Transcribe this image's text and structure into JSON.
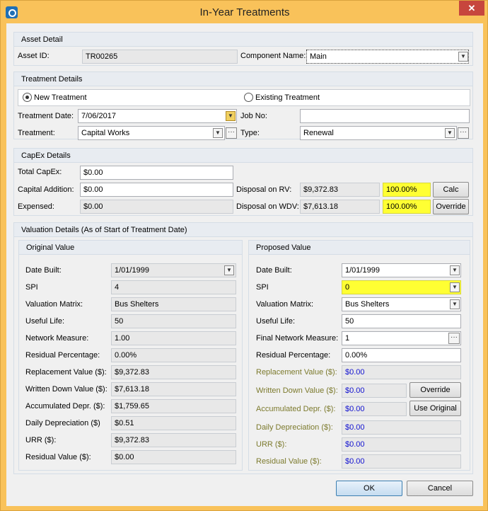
{
  "window": {
    "title": "In-Year Treatments",
    "close_glyph": "✕"
  },
  "asset_detail": {
    "header": "Asset Detail",
    "asset_id_label": "Asset ID:",
    "asset_id": "TR00265",
    "component_label": "Component Name:",
    "component": "Main"
  },
  "treatment_details": {
    "header": "Treatment Details",
    "new_label": "New Treatment",
    "existing_label": "Existing Treatment",
    "selected": "New Treatment",
    "date_label": "Treatment Date:",
    "date": "7/06/2017",
    "job_label": "Job No:",
    "job": "",
    "treatment_label": "Treatment:",
    "treatment": "Capital Works",
    "type_label": "Type:",
    "type": "Renewal"
  },
  "capex": {
    "header": "CapEx Details",
    "total_label": "Total CapEx:",
    "total": "$0.00",
    "addition_label": "Capital Addition:",
    "addition": "$0.00",
    "expensed_label": "Expensed:",
    "expensed": "$0.00",
    "rv_label": "Disposal on RV:",
    "rv": "$9,372.83",
    "rv_pct": "100.00%",
    "wdv_label": "Disposal on WDV:",
    "wdv": "$7,613.18",
    "wdv_pct": "100.00%",
    "calc": "Calc",
    "override": "Override"
  },
  "valuation": {
    "header": "Valuation Details (As of Start of Treatment Date)",
    "original": {
      "header": "Original Value",
      "date_built_label": "Date Built:",
      "date_built": "1/01/1999",
      "spi_label": "SPI",
      "spi": "4",
      "matrix_label": "Valuation Matrix:",
      "matrix": "Bus Shelters",
      "useful_label": "Useful Life:",
      "useful": "50",
      "network_label": "Network Measure:",
      "network": "1.00",
      "residual_pct_label": "Residual Percentage:",
      "residual_pct": "0.00%",
      "replacement_label": "Replacement Value ($):",
      "replacement": "$9,372.83",
      "wdv_label": "Written Down Value ($):",
      "wdv": "$7,613.18",
      "accum_label": "Accumulated Depr. ($):",
      "accum": "$1,759.65",
      "daily_label": "Daily Depreciation ($)",
      "daily": "$0.51",
      "urr_label": "URR ($):",
      "urr": "$9,372.83",
      "residual_val_label": "Residual Value ($):",
      "residual_val": "$0.00"
    },
    "proposed": {
      "header": "Proposed Value",
      "date_built_label": "Date Built:",
      "date_built": "1/01/1999",
      "spi_label": "SPI",
      "spi": "0",
      "matrix_label": "Valuation Matrix:",
      "matrix": "Bus Shelters",
      "useful_label": "Useful Life:",
      "useful": "50",
      "network_label": "Final Network Measure:",
      "network": "1",
      "residual_pct_label": "Residual Percentage:",
      "residual_pct": "0.00%",
      "replacement_label": "Replacement Value ($):",
      "replacement": "$0.00",
      "wdv_label": "Written Down Value ($):",
      "wdv": "$0.00",
      "override": "Override",
      "accum_label": "Accumulated Depr. ($):",
      "accum": "$0.00",
      "use_original": "Use Original",
      "daily_label": "Daily Depreciation  ($):",
      "daily": "$0.00",
      "urr_label": "URR ($):",
      "urr": "$0.00",
      "residual_val_label": "Residual Value ($):",
      "residual_val": "$0.00"
    }
  },
  "footer": {
    "ok": "OK",
    "cancel": "Cancel"
  },
  "colors": {
    "frame": "#f9c25a",
    "highlight": "#ffff33",
    "link_blue": "#1010d0",
    "label_olive": "#7c7a2d"
  }
}
